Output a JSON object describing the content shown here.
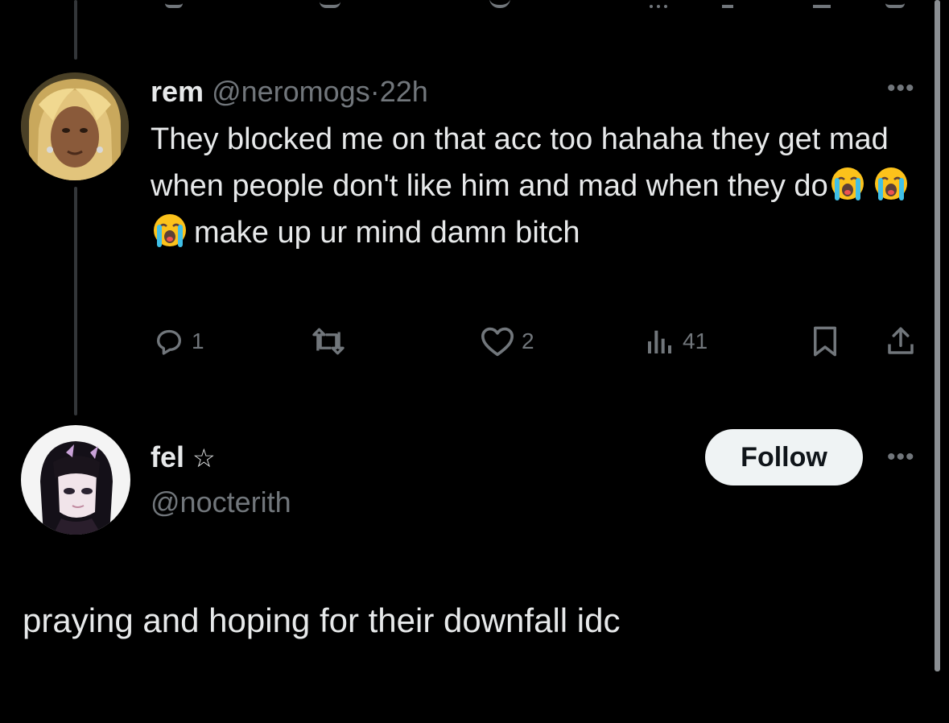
{
  "colors": {
    "background": "#000000",
    "text_primary": "#e7e9ea",
    "text_secondary": "#71767b",
    "follow_button_bg": "#eff3f4",
    "follow_button_text": "#0f1419"
  },
  "reply": {
    "display_name": "rem",
    "handle": "@neromogs",
    "separator": "·",
    "time": "22h",
    "text_part1": "They blocked me on that acc too hahaha they get mad when people don't like him and mad when they do",
    "text_part2": "make up ur mind damn bitch",
    "emojis": [
      "loudly-crying-face",
      "loudly-crying-face",
      "loudly-crying-face"
    ],
    "more_icon": "more-horizontal-icon",
    "actions": {
      "replies": "1",
      "retweets": "",
      "likes": "2",
      "views": "41",
      "icons": [
        "reply-icon",
        "retweet-icon",
        "like-icon",
        "views-icon",
        "bookmark-icon",
        "share-icon"
      ]
    }
  },
  "main_post": {
    "display_name": "fel",
    "name_badge": "☆",
    "handle": "@nocterith",
    "follow_label": "Follow",
    "more_icon": "more-horizontal-icon",
    "text": "praying and hoping for their downfall idc"
  }
}
